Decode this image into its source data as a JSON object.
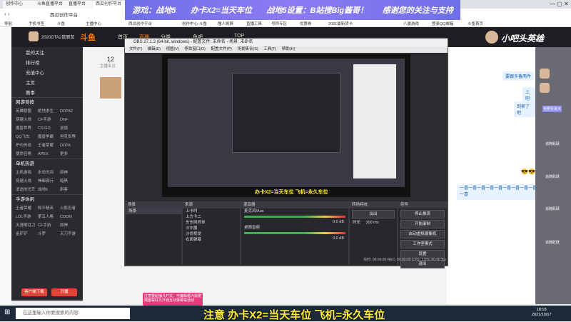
{
  "browser": {
    "tabs": [
      "创作中心",
      "斗鱼直播平台",
      "直播平台",
      "西瓜创作平台"
    ],
    "address": "西瓜创作平台",
    "bookmarks": [
      "导航",
      "手机书签",
      "斗鱼",
      "主播中心",
      "西瓜创作平台",
      "创作中心-斗鱼",
      "懂人刷屏",
      "直播工具",
      "号称专区",
      "优惠券",
      "2021最新货卡",
      "八骏游戏",
      "登录QQ邮箱",
      "斗鱼首页"
    ]
  },
  "banner": {
    "items": [
      "游戏：战地5",
      "办卡X2=当天车位",
      "战地5设置：B站搜Big酱哥！",
      "感谢您的关注与支持"
    ]
  },
  "site": {
    "logo_text": "斗鱼",
    "streamer_name": "2020DTA2鼠面鼠",
    "nav": [
      "首页",
      "直播",
      "分类",
      "鱼吧",
      "TOP"
    ],
    "right_brand": "小吧头英雄",
    "follow_count": "12",
    "follow_label": "主播关注"
  },
  "sidebar": {
    "items": [
      "我的关注",
      "排行榜",
      "充值中心",
      "主页",
      "赛事"
    ],
    "sections": [
      {
        "title": "网游竞技",
        "games": [
          "英雄联盟",
          "绝地求生",
          "DOTA2",
          "穿越火线",
          "CF手游",
          "DNF",
          "魔兽世界",
          "CS:GO",
          "逆战",
          "QQ飞车",
          "魔兽争霸",
          "坦克世界",
          "炉石传说",
          "王者荣耀",
          "DOTA",
          "使命召唤",
          "APEX",
          "更多"
        ]
      },
      {
        "title": "单机热游",
        "games": [
          "主机游戏",
          "永劫无间",
          "原神",
          "穿越火线",
          "神都夜行",
          "暗黑",
          "消逝的光芒",
          "战地5",
          "刺客"
        ]
      },
      {
        "title": "手游休闲",
        "games": [
          "王者荣耀",
          "和平精英",
          "火影忍者",
          "LOL手游",
          "第五人格",
          "CODM",
          "天涯明月刀",
          "CF手游",
          "原神",
          "金铲铲",
          "斗罗",
          "天刀手游"
        ]
      }
    ],
    "bottom_btn1": "客户端下载",
    "bottom_btn2": "开播"
  },
  "obs": {
    "title": "OBS 27.1.3 (64-bit, windows) - 配置文件: 未命名 - 场景: 未命名",
    "menu": [
      "文件(F)",
      "编辑(E)",
      "视图(V)",
      "停靠窗口(D)",
      "配置文件(P)",
      "场景集合(S)",
      "工具(T)",
      "帮助(H)"
    ],
    "status_bar": "实时: 00:00:00  REC: 00:00:00  CPU: 1.5%, 60.00 fps",
    "docks": {
      "scenes": {
        "title": "场景",
        "items": [
          "场景"
        ]
      },
      "sources": {
        "title": "来源",
        "items": [
          "上卡时",
          "上方卡二",
          "东东网师单",
          "沙尔展",
          "沙伐视觉",
          "右面弹幕"
        ]
      },
      "mixer": {
        "title": "混音器",
        "channels": [
          {
            "name": "麦克风/Aux",
            "db": "0.0 dB"
          },
          {
            "name": "桌面音频",
            "db": "0.0 dB"
          }
        ]
      },
      "transitions": {
        "title": "转场特效",
        "type": "淡出",
        "duration_label": "时长",
        "duration": "300 ms"
      },
      "controls": {
        "title": "控件",
        "buttons": [
          "停止推流",
          "开始录制",
          "启动虚拟摄像机",
          "工作室模式",
          "设置",
          "退出"
        ]
      }
    },
    "preview_text": "办卡X2=当天车位 飞机=永久车位"
  },
  "chat": {
    "messages": [
      "要跟多备两件",
      "上吧",
      "到家了吧"
    ],
    "emoji_line": "一喜一喜一喜一喜一喜一喜一喜一喜一喜一喜",
    "side_labels": [
      "我要看夏天",
      "追随跃跃",
      "追随跃跃",
      "追随跃跃",
      "追随跃跃"
    ],
    "right_tab": "追随跃跃"
  },
  "overlay": {
    "bottom_text": "注意 办卡X2=当天车位 飞机=永久车位",
    "notice": "注意要起播凡开关，可编辑框内需要截图等好凡开通互动弹幕等活动"
  },
  "taskbar": {
    "search_placeholder": "在这里输入你要搜索的内容",
    "time": "18:03",
    "date": "2021/10/17"
  }
}
